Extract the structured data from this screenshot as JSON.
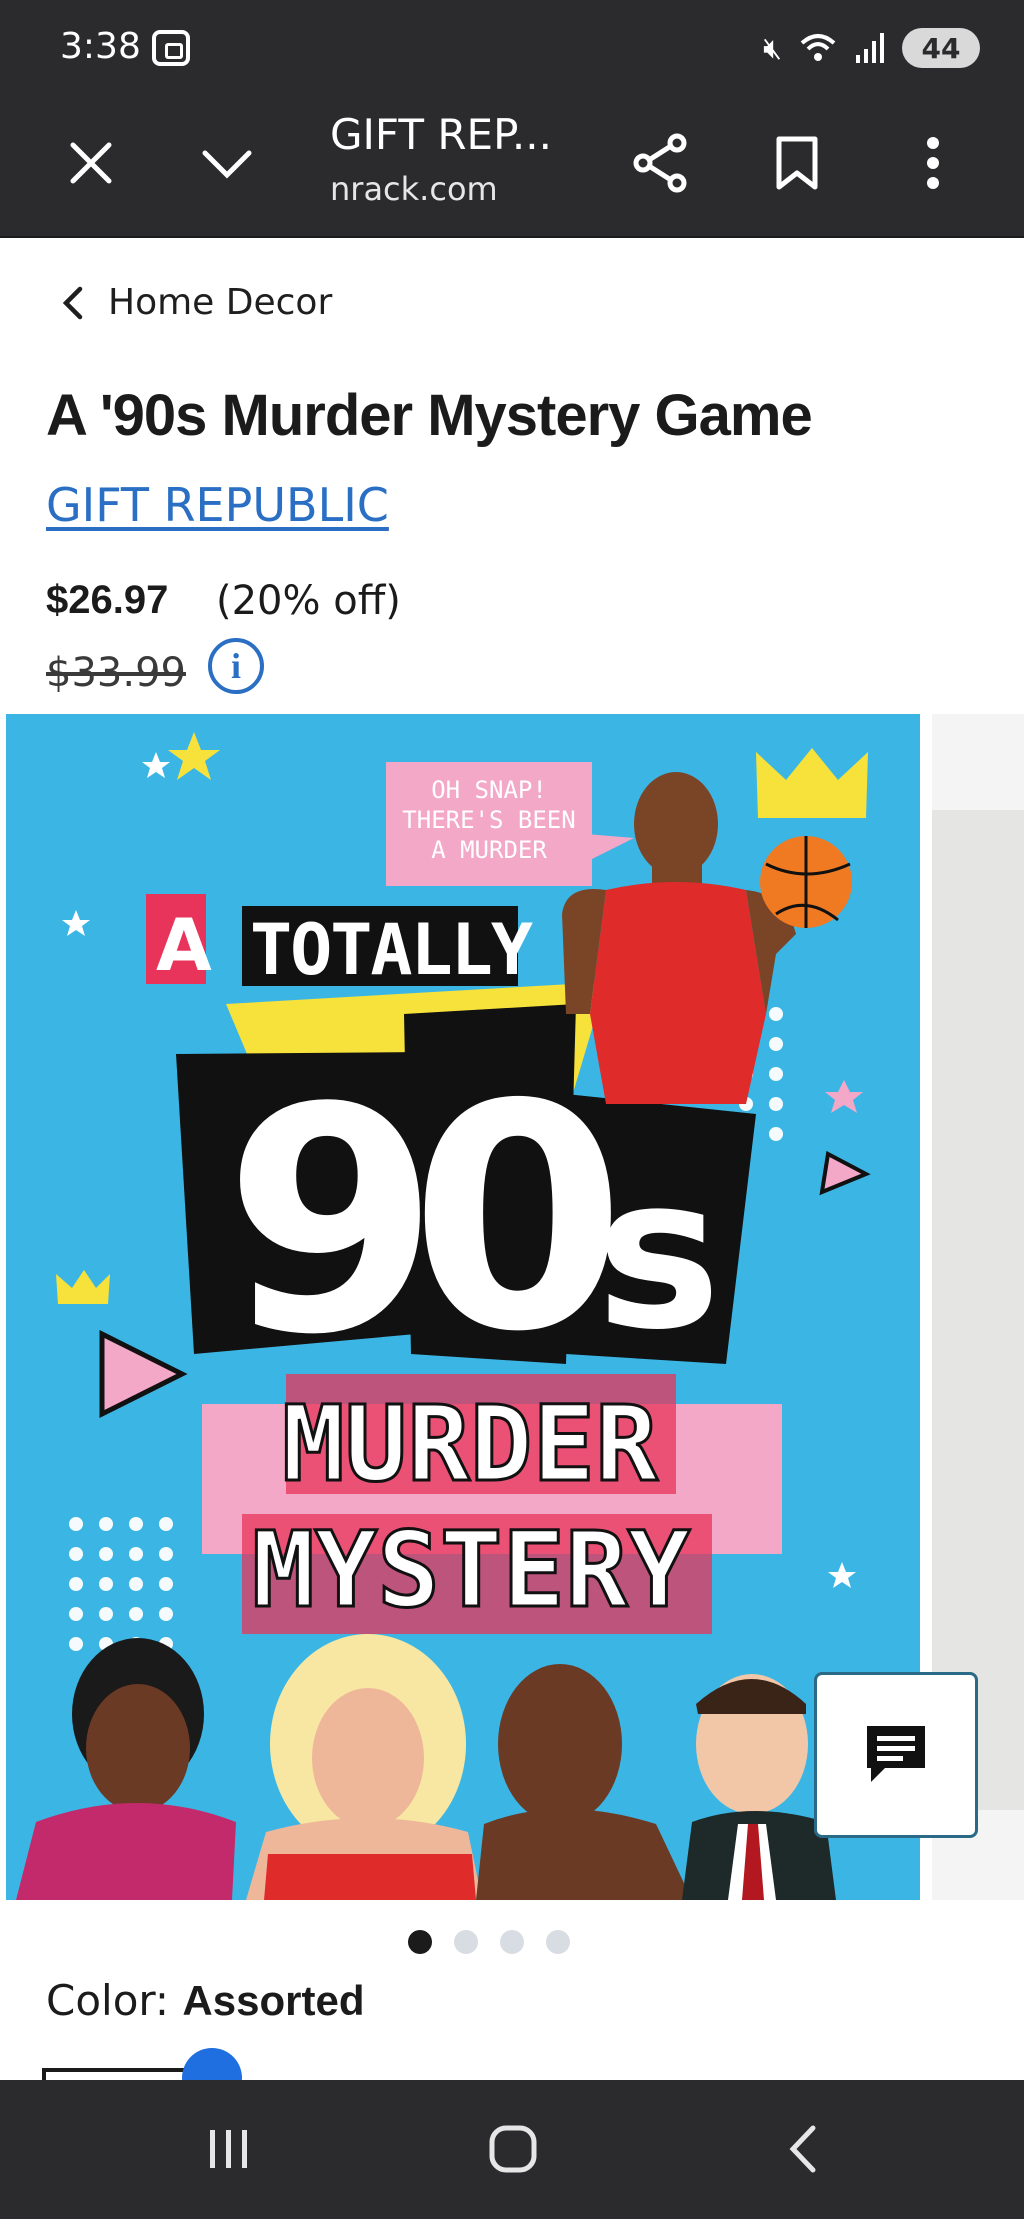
{
  "status_bar": {
    "time": "3:38",
    "icons": [
      "screenshot-icon",
      "mute-icon",
      "wifi-icon",
      "signal-icon"
    ],
    "battery": "44"
  },
  "browser": {
    "page_title": "GIFT REP...",
    "url": "nrack.com",
    "buttons": [
      "close-icon",
      "chevron-down-icon",
      "share-icon",
      "bookmark-icon",
      "more-vert-icon"
    ]
  },
  "breadcrumb": {
    "label": "Home Decor"
  },
  "product": {
    "title": "A '90s Murder Mystery Game",
    "brand": "GIFT REPUBLIC",
    "price": "$26.97",
    "discount": "(20% off)",
    "original_price": "$33.99"
  },
  "artwork": {
    "speech_bubble": [
      "OH SNAP!",
      "THERE'S BEEN",
      "A MURDER"
    ],
    "headline_small": "A TOTALLY",
    "headline_big": "90s",
    "headline_bottom": [
      "MURDER",
      "MYSTERY"
    ]
  },
  "carousel": {
    "count": 4,
    "active": 0
  },
  "color": {
    "label": "Color: ",
    "value": "Assorted"
  },
  "colors": {
    "link": "#2a6fc4",
    "chrome": "#2b2b2d",
    "art_bg": "#3bb6e4"
  }
}
